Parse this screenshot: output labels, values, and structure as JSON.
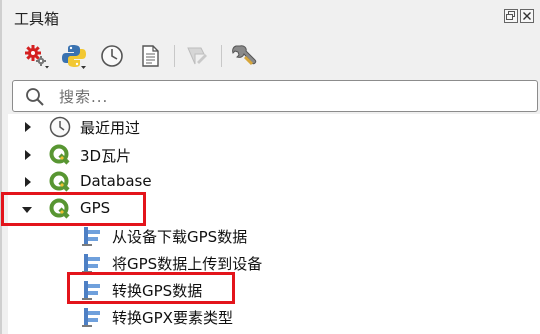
{
  "panel": {
    "title": "工具箱"
  },
  "toolbar": {
    "tools": [
      {
        "icon": "processing-gear-icon"
      },
      {
        "icon": "python-icon"
      },
      {
        "icon": "history-clock-icon"
      },
      {
        "icon": "results-document-icon"
      },
      {
        "icon": "edit-model-icon"
      },
      {
        "icon": "options-wrench-icon"
      }
    ]
  },
  "search": {
    "placeholder": "搜索..."
  },
  "tree": {
    "items": [
      {
        "label": "最近用过",
        "icon": "clock-icon",
        "expanded": false
      },
      {
        "label": "3D瓦片",
        "icon": "qgis-icon",
        "expanded": false
      },
      {
        "label": "Database",
        "icon": "qgis-icon",
        "expanded": false
      },
      {
        "label": "GPS",
        "icon": "qgis-icon",
        "expanded": true
      },
      {
        "label": "从设备下载GPS数据",
        "icon": "gps-tool-icon"
      },
      {
        "label": "将GPS数据上传到设备",
        "icon": "gps-tool-icon"
      },
      {
        "label": "转换GPS数据",
        "icon": "gps-tool-icon"
      },
      {
        "label": "转换GPX要素类型",
        "icon": "gps-tool-icon"
      }
    ]
  },
  "colors": {
    "highlight": "#e3141b",
    "qgis_green": "#589632"
  }
}
